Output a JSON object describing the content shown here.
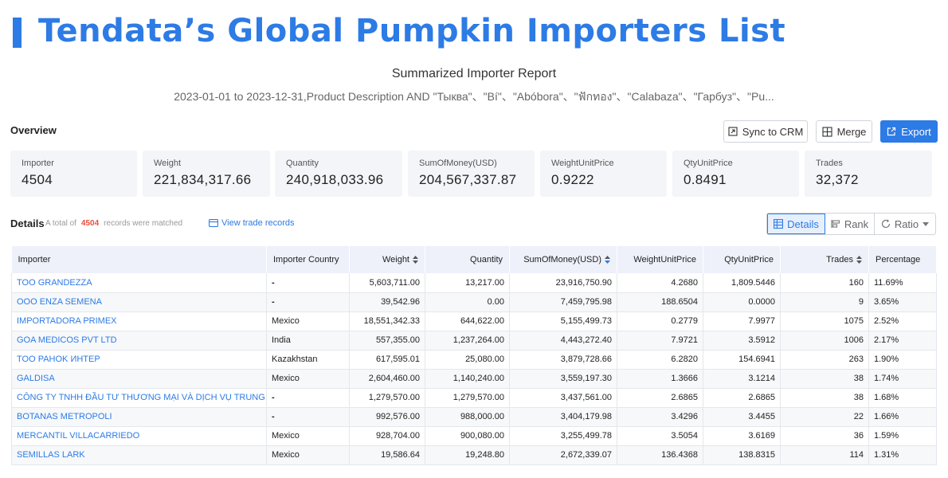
{
  "header": {
    "title": "Tendata’s Global Pumpkin Importers List",
    "report_title": "Summarized Importer Report",
    "report_subtitle": "2023-01-01 to 2023-12-31,Product Description AND \"Тыква\"、\"Bí\"、\"Abóbora\"、\"ฟักทอง\"、\"Calabaza\"、\"Гарбуз\"、\"Pu..."
  },
  "overview": {
    "label": "Overview",
    "buttons": {
      "sync": "Sync to CRM",
      "merge": "Merge",
      "export": "Export"
    },
    "stats": [
      {
        "label": "Importer",
        "value": "4504"
      },
      {
        "label": "Weight",
        "value": "221,834,317.66"
      },
      {
        "label": "Quantity",
        "value": "240,918,033.96"
      },
      {
        "label": "SumOfMoney(USD)",
        "value": "204,567,337.87"
      },
      {
        "label": "WeightUnitPrice",
        "value": "0.9222"
      },
      {
        "label": "QtyUnitPrice",
        "value": "0.8491"
      },
      {
        "label": "Trades",
        "value": "32,372"
      }
    ]
  },
  "details": {
    "label": "Details",
    "match_prefix": "A total of",
    "match_count": "4504",
    "match_suffix": "records were matched",
    "view_link": "View trade records",
    "tabs": {
      "details": "Details",
      "rank": "Rank",
      "ratio": "Ratio"
    }
  },
  "table": {
    "headers": {
      "importer": "Importer",
      "country": "Importer Country",
      "weight": "Weight",
      "quantity": "Quantity",
      "money": "SumOfMoney(USD)",
      "wup": "WeightUnitPrice",
      "qup": "QtyUnitPrice",
      "trades": "Trades",
      "pct": "Percentage"
    },
    "rows": [
      {
        "importer": "TOO GRANDEZZA",
        "country": "-",
        "weight": "5,603,711.00",
        "quantity": "13,217.00",
        "money": "23,916,750.90",
        "wup": "4.2680",
        "qup": "1,809.5446",
        "trades": "160",
        "pct": "11.69%"
      },
      {
        "importer": "OOO ENZA SEMENA",
        "country": "-",
        "weight": "39,542.96",
        "quantity": "0.00",
        "money": "7,459,795.98",
        "wup": "188.6504",
        "qup": "0.0000",
        "trades": "9",
        "pct": "3.65%"
      },
      {
        "importer": "IMPORTADORA PRIMEX",
        "country": "Mexico",
        "weight": "18,551,342.33",
        "quantity": "644,622.00",
        "money": "5,155,499.73",
        "wup": "0.2779",
        "qup": "7.9977",
        "trades": "1075",
        "pct": "2.52%"
      },
      {
        "importer": "GOA MEDICOS PVT LTD",
        "country": "India",
        "weight": "557,355.00",
        "quantity": "1,237,264.00",
        "money": "4,443,272.40",
        "wup": "7.9721",
        "qup": "3.5912",
        "trades": "1006",
        "pct": "2.17%"
      },
      {
        "importer": "TOO PAHOK ИНТЕР",
        "country": "Kazakhstan",
        "weight": "617,595.01",
        "quantity": "25,080.00",
        "money": "3,879,728.66",
        "wup": "6.2820",
        "qup": "154.6941",
        "trades": "263",
        "pct": "1.90%"
      },
      {
        "importer": "GALDISA",
        "country": "Mexico",
        "weight": "2,604,460.00",
        "quantity": "1,140,240.00",
        "money": "3,559,197.30",
        "wup": "1.3666",
        "qup": "3.1214",
        "trades": "38",
        "pct": "1.74%"
      },
      {
        "importer": "CÔNG TY TNHH ĐẦU TƯ THƯƠNG MẠI VÀ DỊCH VỤ TRUNG ĐÔNG",
        "country": "-",
        "weight": "1,279,570.00",
        "quantity": "1,279,570.00",
        "money": "3,437,561.00",
        "wup": "2.6865",
        "qup": "2.6865",
        "trades": "38",
        "pct": "1.68%"
      },
      {
        "importer": "BOTANAS METROPOLI",
        "country": "-",
        "weight": "992,576.00",
        "quantity": "988,000.00",
        "money": "3,404,179.98",
        "wup": "3.4296",
        "qup": "3.4455",
        "trades": "22",
        "pct": "1.66%"
      },
      {
        "importer": "MERCANTIL VILLACARRIEDO",
        "country": "Mexico",
        "weight": "928,704.00",
        "quantity": "900,080.00",
        "money": "3,255,499.78",
        "wup": "3.5054",
        "qup": "3.6169",
        "trades": "36",
        "pct": "1.59%"
      },
      {
        "importer": "SEMILLAS LARK",
        "country": "Mexico",
        "weight": "19,586.64",
        "quantity": "19,248.80",
        "money": "2,672,339.07",
        "wup": "136.4368",
        "qup": "138.8315",
        "trades": "114",
        "pct": "1.31%"
      }
    ]
  },
  "colors": {
    "accent": "#2d7be5",
    "count_highlight": "#e8503a",
    "header_bg": "#eef1fa",
    "card_bg": "#f3f5f8"
  }
}
